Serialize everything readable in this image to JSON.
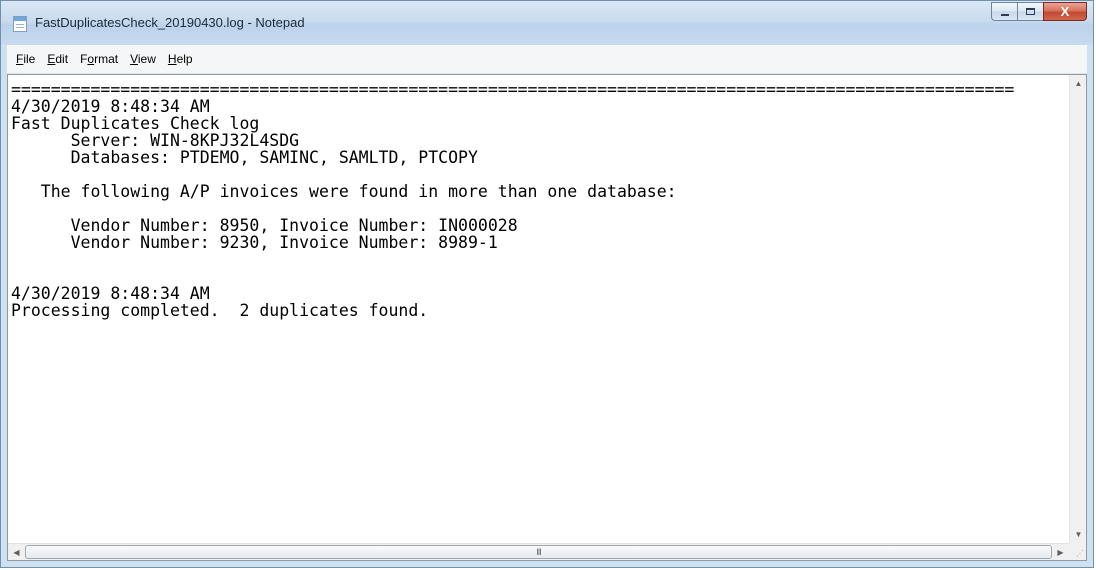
{
  "window": {
    "title": "FastDuplicatesCheck_20190430.log - Notepad",
    "icon": "notepad-icon"
  },
  "caption_buttons": {
    "minimize_icon": "minimize-icon",
    "maximize_icon": "maximize-icon",
    "close_label": "X"
  },
  "menu": {
    "items": [
      {
        "label": "File",
        "mnemonic": "F"
      },
      {
        "label": "Edit",
        "mnemonic": "E"
      },
      {
        "label": "Format",
        "mnemonic": "o"
      },
      {
        "label": "View",
        "mnemonic": "V"
      },
      {
        "label": "Help",
        "mnemonic": "H"
      }
    ]
  },
  "document": {
    "text": "=====================================================================================================\n4/30/2019 8:48:34 AM\nFast Duplicates Check log\n      Server: WIN-8KPJ32L4SDG\n      Databases: PTDEMO, SAMINC, SAMLTD, PTCOPY\n\n   The following A/P invoices were found in more than one database:\n\n      Vendor Number: 8950, Invoice Number: IN000028\n      Vendor Number: 9230, Invoice Number: 8989-1\n\n\n4/30/2019 8:48:34 AM\nProcessing completed.  2 duplicates found."
  },
  "scrollbars": {
    "hthumb_grip": "III",
    "sizegrip": "size-grip-icon"
  },
  "colors": {
    "title_bar": "#c9dbee",
    "close_button": "#c24a31"
  }
}
